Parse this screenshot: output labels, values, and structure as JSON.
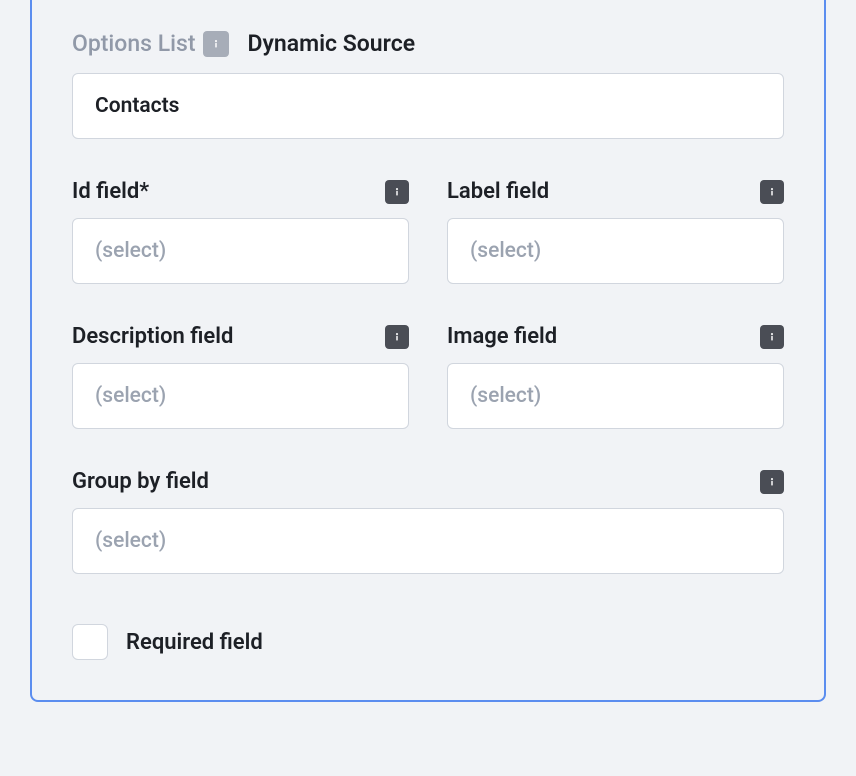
{
  "tabs": {
    "options_list": "Options List",
    "dynamic_source": "Dynamic Source"
  },
  "source": {
    "value": "Contacts"
  },
  "fields": {
    "id": {
      "label": "Id field*",
      "placeholder": "(select)"
    },
    "label": {
      "label": "Label field",
      "placeholder": "(select)"
    },
    "description": {
      "label": "Description field",
      "placeholder": "(select)"
    },
    "image": {
      "label": "Image field",
      "placeholder": "(select)"
    },
    "group_by": {
      "label": "Group by field",
      "placeholder": "(select)"
    }
  },
  "required": {
    "label": "Required field"
  }
}
